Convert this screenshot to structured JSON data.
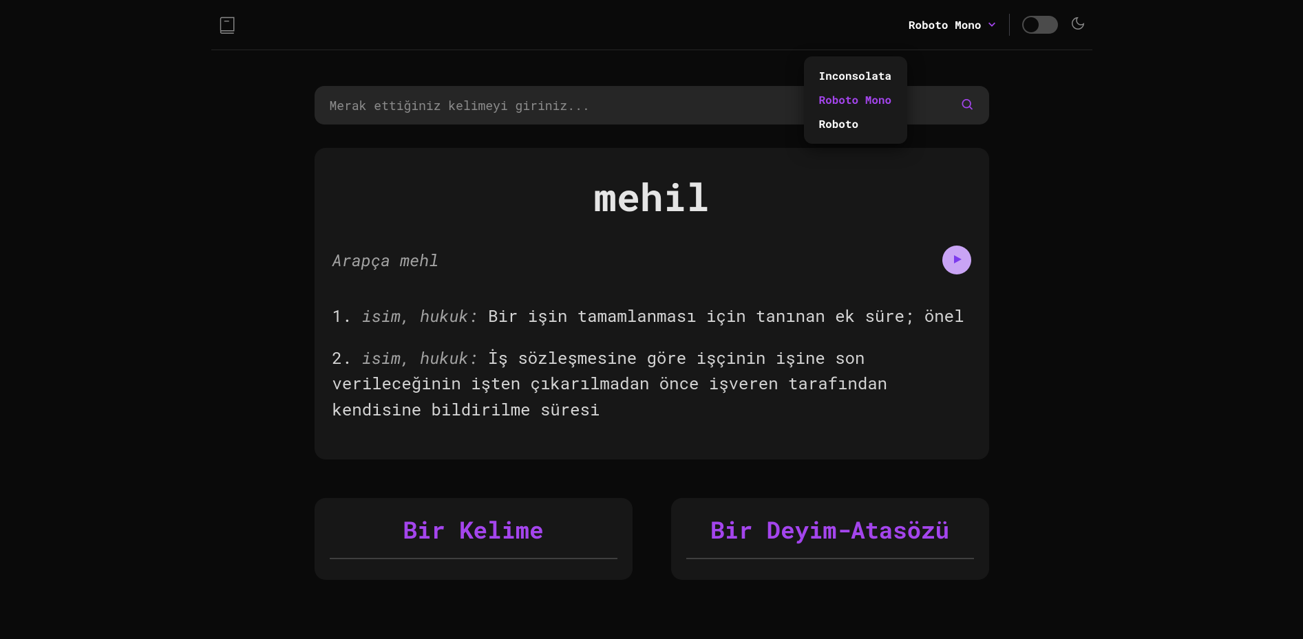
{
  "header": {
    "font_selected": "Roboto Mono",
    "fonts": [
      "Inconsolata",
      "Roboto Mono",
      "Roboto"
    ],
    "active_font_index": 1
  },
  "search": {
    "placeholder": "Merak ettiğiniz kelimeyi giriniz...",
    "value": ""
  },
  "word": {
    "title": "mehil",
    "etymology": "Arapça mehl",
    "definitions": [
      {
        "num": "1.",
        "tag": "isim, hukuk:",
        "text": "Bir işin tamamlanması için tanınan ek süre; önel"
      },
      {
        "num": "2.",
        "tag": "isim, hukuk:",
        "text": "İş sözleşmesine göre işçinin işine son verileceğinin işten çıkarılmadan önce işveren tarafından kendisine bildirilme süresi"
      }
    ]
  },
  "columns": {
    "left_title": "Bir Kelime",
    "right_title": "Bir Deyim-Atasözü"
  },
  "colors": {
    "accent": "#a445ed",
    "bg": "#0a0a0a",
    "card": "#171717"
  }
}
